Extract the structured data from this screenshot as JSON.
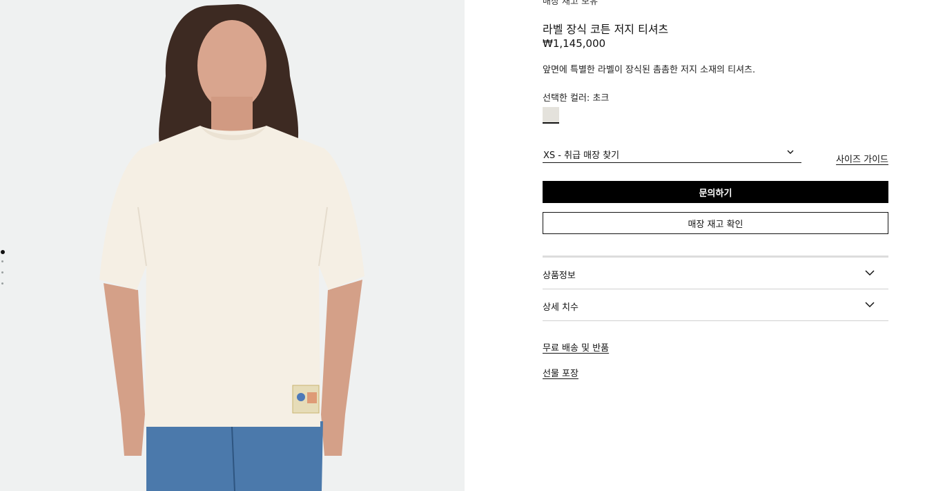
{
  "gallery": {
    "image_alt": "Model wearing label-decorated cotton jersey t-shirt",
    "dots": 4,
    "active_dot": 0
  },
  "product": {
    "stock_status": "매장 재고 보유",
    "title": "라벨 장식 코튼 저지 티셔츠",
    "price": "₩1,145,000",
    "description": "앞면에 특별한 라벨이 장식된 촘촘한 저지 소재의 티셔츠.",
    "color_label": "선택한 컬러: 초크",
    "color_swatch": "#e4e2dc",
    "size_select": "XS - 취급 매장 찾기",
    "size_guide": "사이즈 가이드"
  },
  "actions": {
    "inquire": "문의하기",
    "check_store_stock": "매장 재고 확인"
  },
  "accordion": {
    "product_info": "상품정보",
    "detailed_sizes": "상세 치수"
  },
  "links": {
    "free_shipping_returns": "무료 배송 및 반품",
    "gift_wrapping": "선물 포장"
  }
}
